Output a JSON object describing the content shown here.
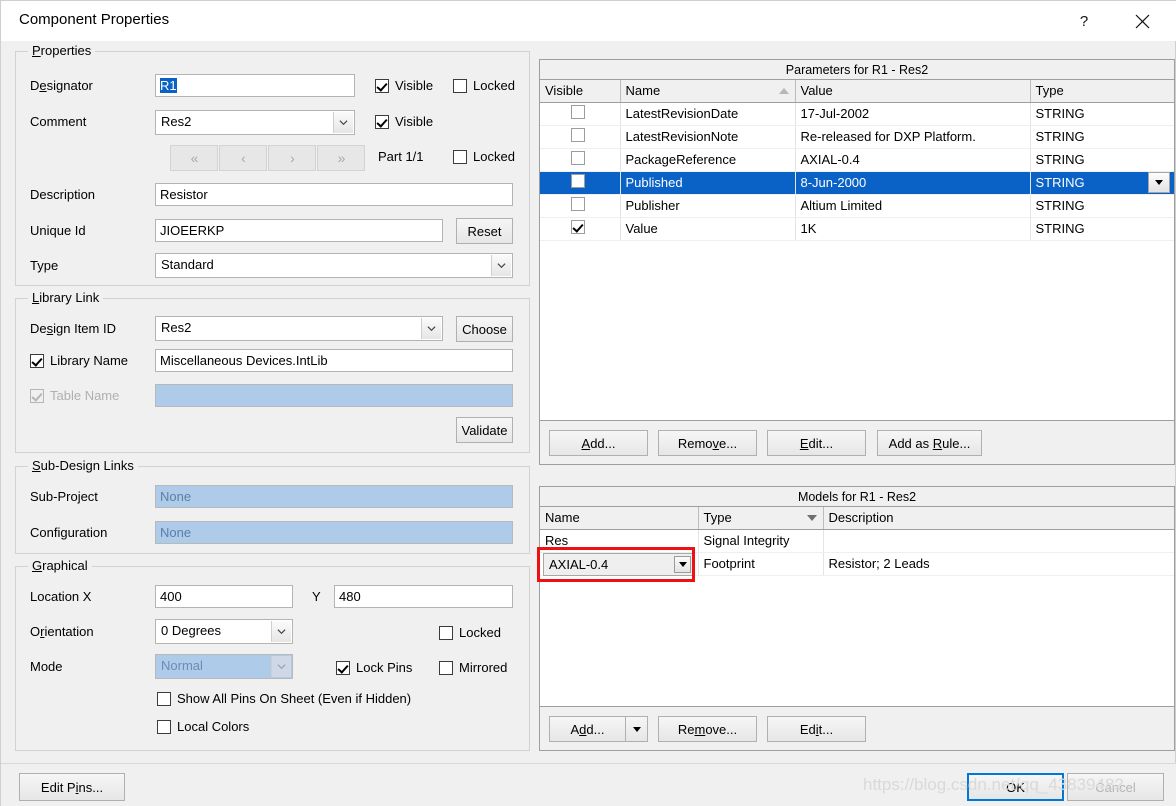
{
  "window": {
    "title": "Component Properties",
    "help_icon": "?",
    "close_icon": "close-icon"
  },
  "properties": {
    "legend": "Properties",
    "designator": {
      "label": "Designator",
      "value": "R1",
      "visible_label": "Visible",
      "visible_checked": true,
      "locked_label": "Locked",
      "locked_checked": false
    },
    "comment": {
      "label": "Comment",
      "value": "Res2",
      "visible_label": "Visible",
      "visible_checked": true
    },
    "part_nav": {
      "first": "«",
      "prev": "‹",
      "next": "›",
      "last": "»",
      "part_label": "Part 1/1",
      "locked_label": "Locked",
      "locked_checked": false
    },
    "description": {
      "label": "Description",
      "value": "Resistor"
    },
    "unique_id": {
      "label": "Unique Id",
      "value": "JIOEERKP",
      "reset_label": "Reset"
    },
    "type": {
      "label": "Type",
      "value": "Standard"
    }
  },
  "library_link": {
    "legend": "Library Link",
    "design_item_id": {
      "label": "Design Item ID",
      "value": "Res2",
      "choose_label": "Choose"
    },
    "library_name": {
      "label": "Library Name",
      "checked": true,
      "value": "Miscellaneous Devices.IntLib"
    },
    "table_name": {
      "label": "Table Name",
      "checked": true,
      "value": "",
      "disabled": true
    },
    "validate_label": "Validate"
  },
  "sub_design_links": {
    "legend": "Sub-Design Links",
    "sub_project": {
      "label": "Sub-Project",
      "value": "None"
    },
    "configuration": {
      "label": "Configuration",
      "value": "None"
    }
  },
  "graphical": {
    "legend": "Graphical",
    "location": {
      "label": "Location X",
      "x": "400",
      "y_label": "Y",
      "y": "480"
    },
    "orientation": {
      "label": "Orientation",
      "value": "0 Degrees"
    },
    "locked": {
      "label": "Locked",
      "checked": false
    },
    "mode": {
      "label": "Mode",
      "value": "Normal",
      "disabled": true
    },
    "lock_pins": {
      "label": "Lock Pins",
      "checked": true
    },
    "mirrored": {
      "label": "Mirrored",
      "checked": false
    },
    "show_all_pins": {
      "label": "Show All Pins On Sheet (Even if Hidden)",
      "checked": false
    },
    "local_colors": {
      "label": "Local Colors",
      "checked": false
    }
  },
  "parameters_panel": {
    "caption": "Parameters for R1 - Res2",
    "columns": [
      "Visible",
      "Name",
      "Value",
      "Type"
    ],
    "sort_column": "Name",
    "sort_direction": "asc",
    "rows": [
      {
        "visible": false,
        "name": "LatestRevisionDate",
        "value": "17-Jul-2002",
        "type": "STRING",
        "selected": false
      },
      {
        "visible": false,
        "name": "LatestRevisionNote",
        "value": "Re-released for DXP Platform.",
        "type": "STRING",
        "selected": false
      },
      {
        "visible": false,
        "name": "PackageReference",
        "value": "AXIAL-0.4",
        "type": "STRING",
        "selected": false
      },
      {
        "visible": false,
        "name": "Published",
        "value": "8-Jun-2000",
        "type": "STRING",
        "selected": true
      },
      {
        "visible": false,
        "name": "Publisher",
        "value": "Altium Limited",
        "type": "STRING",
        "selected": false
      },
      {
        "visible": true,
        "name": "Value",
        "value": "1K",
        "type": "STRING",
        "selected": false
      }
    ],
    "buttons": {
      "add": "Add...",
      "remove": "Remove...",
      "edit": "Edit...",
      "add_as_rule": "Add as Rule..."
    }
  },
  "models_panel": {
    "caption": "Models for R1 - Res2",
    "columns": [
      "Name",
      "Type",
      "Description"
    ],
    "sort_column": "Type",
    "sort_direction": "desc",
    "rows": [
      {
        "name": "Res",
        "type": "Signal Integrity",
        "description": ""
      },
      {
        "name": "AXIAL-0.4",
        "type": "Footprint",
        "description": "Resistor; 2 Leads",
        "editing": true
      }
    ],
    "buttons": {
      "add": "Add...",
      "add_dropdown": "▾",
      "remove": "Remove...",
      "edit": "Edit..."
    }
  },
  "footer": {
    "edit_pins": "Edit Pins...",
    "ok": "OK",
    "cancel": "Cancel",
    "watermark": "https://blog.csdn.net/qq_43839482"
  },
  "colors": {
    "selection_blue": "#0a62c7",
    "disabled_field": "#aecbea",
    "focus_border": "#0078d7",
    "annotation_red": "#ee1111"
  }
}
